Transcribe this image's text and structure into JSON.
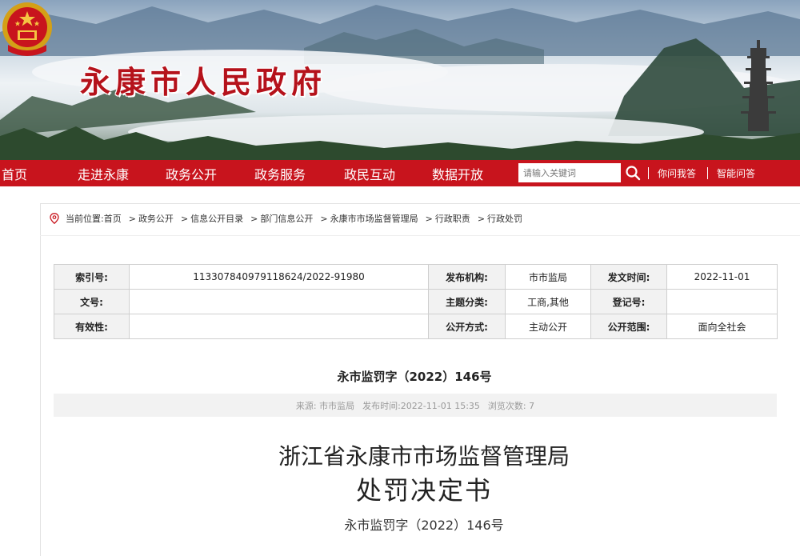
{
  "header": {
    "site_title": "永康市人民政府",
    "emblem_icon": "national-emblem-icon",
    "brand_color": "#c8141d"
  },
  "nav": {
    "items": [
      "首页",
      "走进永康",
      "政务公开",
      "政务服务",
      "政民互动",
      "数据开放"
    ],
    "search_placeholder": "请输入关键词",
    "search_icon": "search-icon",
    "links": [
      "你问我答",
      "智能问答"
    ]
  },
  "breadcrumb": {
    "prefix": "当前位置:",
    "items": [
      "首页",
      "政务公开",
      "信息公开目录",
      "部门信息公开",
      "永康市市场监督管理局",
      "行政职责",
      "行政处罚"
    ],
    "separator": ">"
  },
  "meta": {
    "rows": [
      [
        {
          "label": "索引号:",
          "value": "113307840979118624/2022-91980"
        },
        {
          "label": "发布机构:",
          "value": "市市监局"
        },
        {
          "label": "发文时间:",
          "value": "2022-11-01"
        }
      ],
      [
        {
          "label": "文号:",
          "value": ""
        },
        {
          "label": "主题分类:",
          "value": "工商,其他"
        },
        {
          "label": "登记号:",
          "value": ""
        }
      ],
      [
        {
          "label": "有效性:",
          "value": ""
        },
        {
          "label": "公开方式:",
          "value": "主动公开"
        },
        {
          "label": "公开范围:",
          "value": "面向全社会"
        }
      ]
    ]
  },
  "document": {
    "number": "永市监罚字（2022）146号",
    "info": {
      "source": "来源: 市市监局",
      "published": "发布时间:2022-11-01  15:35",
      "views": "浏览次数: 7"
    },
    "title_line1": "浙江省永康市市场监督管理局",
    "title_line2": "处罚决定书",
    "number_line": "永市监罚字（2022）146号"
  }
}
